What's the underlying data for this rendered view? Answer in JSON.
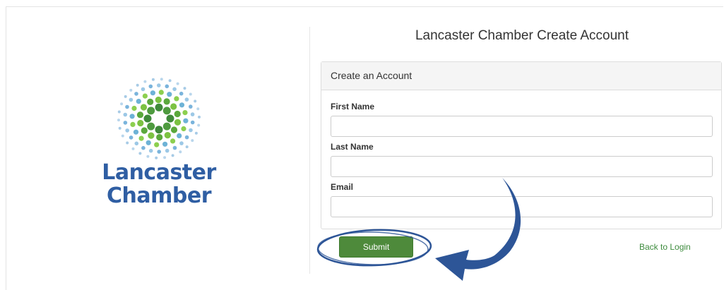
{
  "logo": {
    "line1": "Lancaster",
    "line2": "Chamber"
  },
  "page": {
    "title": "Lancaster Chamber Create Account"
  },
  "form": {
    "panel_heading": "Create an Account",
    "first_name_label": "First Name",
    "first_name_value": "",
    "last_name_label": "Last Name",
    "last_name_value": "",
    "email_label": "Email",
    "email_value": "",
    "submit_label": "Submit",
    "back_link": "Back to Login"
  },
  "colors": {
    "brand_blue": "#2f5ea3",
    "submit_green": "#4e8a3b",
    "link_green": "#3d8b3d",
    "annotation_blue": "#2d5597"
  },
  "annotation": {
    "shape": "circle-around-submit",
    "arrow": "curved-arrow-pointing-to-submit"
  }
}
